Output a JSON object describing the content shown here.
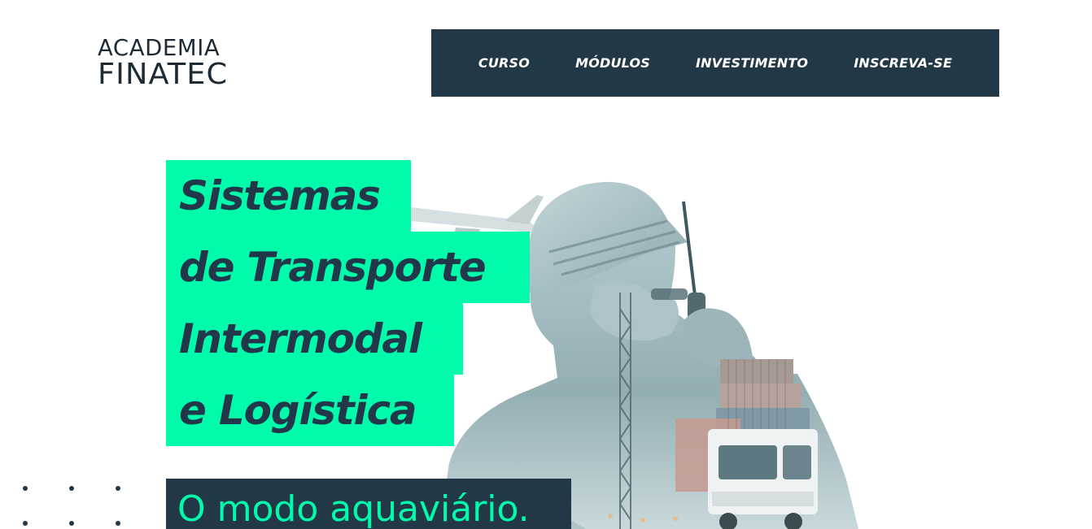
{
  "logo": {
    "line1": "ACADEMIA",
    "line2": "FINATEC"
  },
  "nav": {
    "items": [
      {
        "label": "CURSO"
      },
      {
        "label": "MÓDULOS"
      },
      {
        "label": "INVESTIMENTO"
      },
      {
        "label": "INSCREVA-SE"
      }
    ]
  },
  "hero": {
    "title_lines": [
      "Sistemas",
      "de Transporte",
      "Intermodal",
      "e Logística"
    ],
    "subtitle": "O modo aquaviário.",
    "image_icon": "worker-with-radio-cargo-composite"
  },
  "colors": {
    "accent": "#00fbab",
    "dark": "#233847",
    "title_text": "#22384a",
    "background": "#ffffff"
  }
}
